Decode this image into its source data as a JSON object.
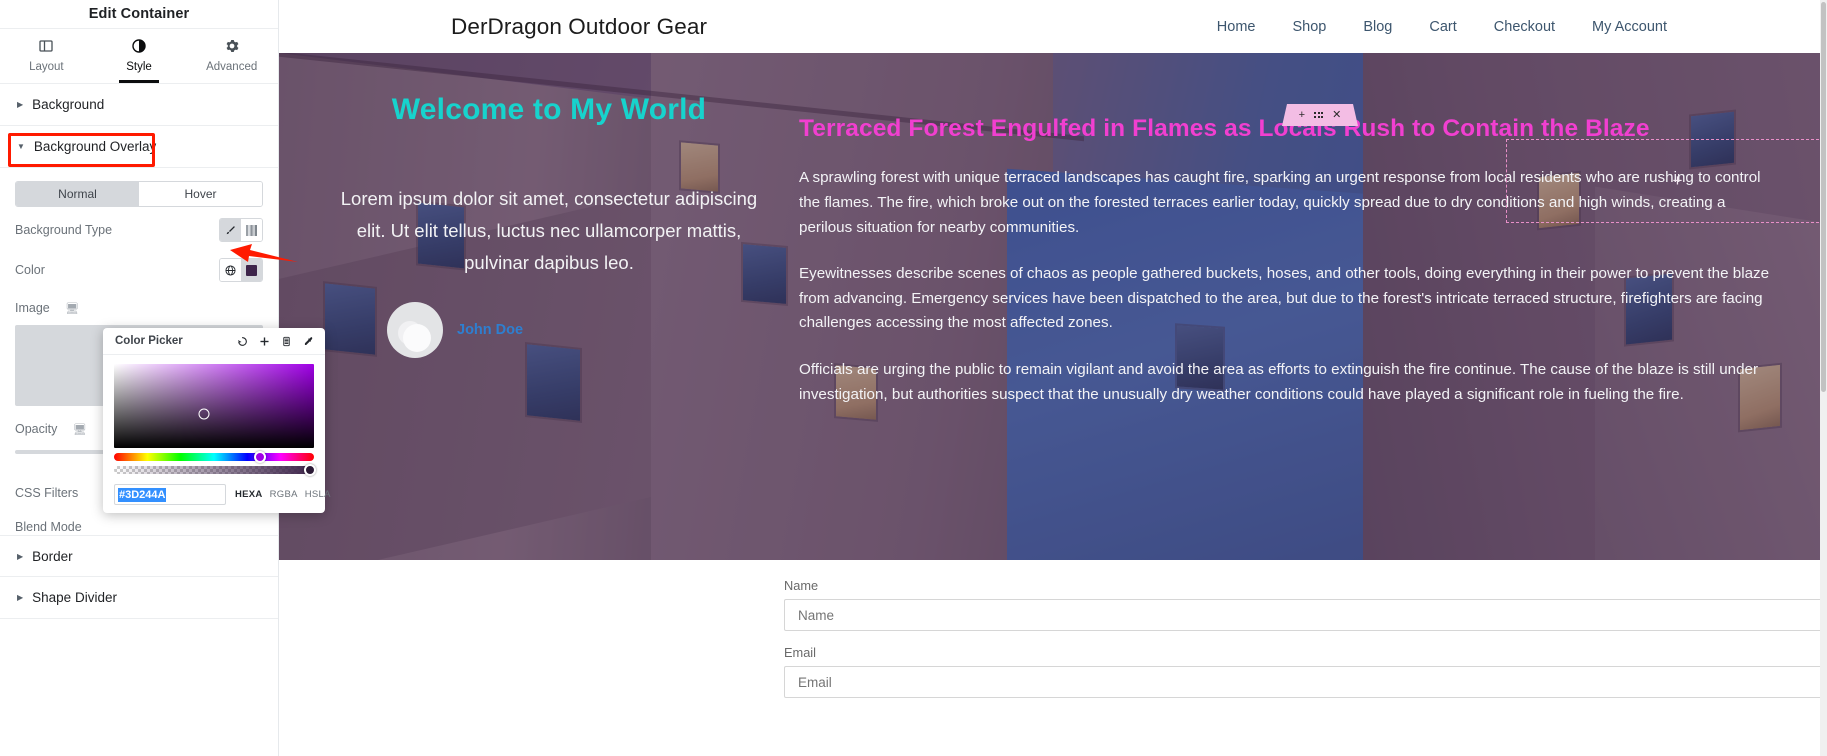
{
  "sidebar": {
    "title": "Edit Container",
    "tabs": [
      {
        "label": "Layout",
        "icon": "layout-icon",
        "active": false
      },
      {
        "label": "Style",
        "icon": "style-contrast-icon",
        "active": true
      },
      {
        "label": "Advanced",
        "icon": "gear-icon",
        "active": false
      }
    ],
    "sections": {
      "background": "Background",
      "background_overlay": "Background Overlay",
      "border": "Border",
      "shape_divider": "Shape Divider"
    },
    "state_tabs": {
      "normal": "Normal",
      "hover": "Hover",
      "active": "Normal"
    },
    "controls": {
      "background_type": "Background Type",
      "color": "Color",
      "image": "Image",
      "opacity": "Opacity",
      "css_filters": "CSS Filters",
      "blend_mode": "Blend Mode"
    },
    "highlight_color": "#ff1a00"
  },
  "color_picker": {
    "title": "Color Picker",
    "hex_value": "#3D244A",
    "formats": [
      "HEXA",
      "RGBA",
      "HSLA"
    ],
    "active_format": "HEXA",
    "actions": [
      "reset-icon",
      "add-icon",
      "library-icon",
      "eyedropper-icon"
    ],
    "swatch_color": "#3D244A"
  },
  "site": {
    "logo": "DerDragon Outdoor Gear",
    "nav": [
      "Home",
      "Shop",
      "Blog",
      "Cart",
      "Checkout",
      "My Account"
    ]
  },
  "hero": {
    "heading": "Welcome to My World",
    "heading_color": "#17d3cd",
    "paragraph": "Lorem ipsum dolor sit amet, consectetur adipiscing elit. Ut elit tellus, luctus nec ullamcorper mattis, pulvinar dapibus leo.",
    "author": "John Doe"
  },
  "article": {
    "heading": "Terraced Forest Engulfed in Flames as Locals Rush to Contain the Blaze",
    "heading_color": "#f13fd0",
    "paragraphs": [
      "A sprawling forest with unique terraced landscapes has caught fire, sparking an urgent response from local residents who are rushing to control the flames. The fire, which broke out on the forested terraces earlier today, quickly spread due to dry conditions and high winds, creating a perilous situation for nearby communities.",
      "Eyewitnesses describe scenes of chaos as people gathered buckets, hoses, and other tools, doing everything in their power to prevent the blaze from advancing. Emergency services have been dispatched to the area, but due to the forest's intricate terraced structure, firefighters are facing challenges accessing the most affected zones.",
      "Officials are urging the public to remain vigilant and avoid the area as efforts to extinguish the fire continue. The cause of the blaze is still under investigation, but authorities suspect that the unusually dry weather conditions could have played a significant role in fueling the fire."
    ]
  },
  "editor_overlay": {
    "toolbar_icons": [
      "add-icon",
      "drag-handle-icon",
      "close-icon"
    ],
    "dropzone_icon": "plus-icon"
  },
  "form": {
    "fields": [
      {
        "label": "Name",
        "placeholder": "Name",
        "value": ""
      },
      {
        "label": "Email",
        "placeholder": "Email",
        "value": ""
      }
    ]
  }
}
